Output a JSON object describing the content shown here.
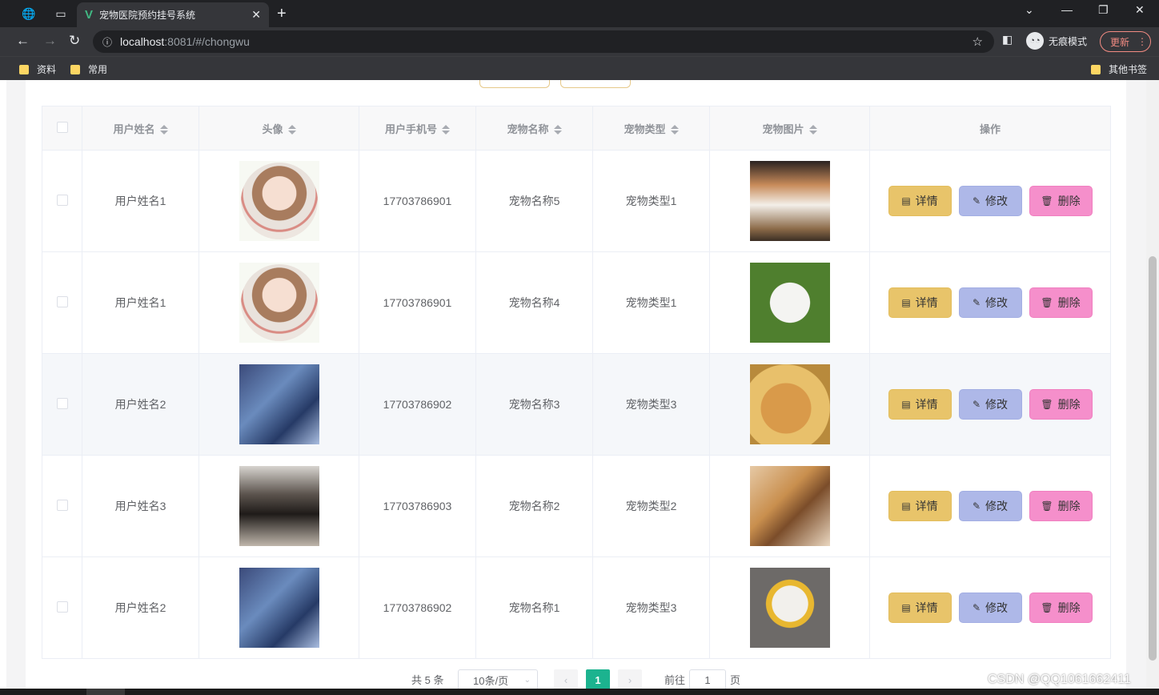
{
  "browser": {
    "tab_title": "宠物医院预约挂号系统",
    "url_host": "localhost",
    "url_path": ":8081/#/chongwu",
    "incognito_label": "无痕模式",
    "update_label": "更新",
    "bookmarks": [
      "资料",
      "常用"
    ],
    "other_bookmarks": "其他书签"
  },
  "table": {
    "headers": [
      "用户姓名",
      "头像",
      "用户手机号",
      "宠物名称",
      "宠物类型",
      "宠物图片",
      "操作"
    ],
    "rows": [
      {
        "name": "用户姓名1",
        "avatar": "avatar-girl",
        "phone": "17703786901",
        "pet_name": "宠物名称5",
        "pet_type": "宠物类型1",
        "pet_img": "corgi"
      },
      {
        "name": "用户姓名1",
        "avatar": "avatar-girl",
        "phone": "17703786901",
        "pet_name": "宠物名称4",
        "pet_type": "宠物类型1",
        "pet_img": "westie"
      },
      {
        "name": "用户姓名2",
        "avatar": "avatar-boy-blue",
        "phone": "17703786902",
        "pet_name": "宠物名称3",
        "pet_type": "宠物类型3",
        "pet_img": "golden"
      },
      {
        "name": "用户姓名3",
        "avatar": "avatar-boy-gray",
        "phone": "17703786903",
        "pet_name": "宠物名称2",
        "pet_type": "宠物类型2",
        "pet_img": "puppy"
      },
      {
        "name": "用户姓名2",
        "avatar": "avatar-boy-blue",
        "phone": "17703786902",
        "pet_name": "宠物名称1",
        "pet_type": "宠物类型3",
        "pet_img": "maltese"
      }
    ],
    "actions": {
      "detail": "详情",
      "edit": "修改",
      "delete": "删除"
    }
  },
  "pagination": {
    "total": "共 5 条",
    "page_size": "10条/页",
    "current_page": "1",
    "goto_label": "前往",
    "goto_value": "1",
    "page_suffix": "页"
  },
  "watermark": "CSDN @QQ1061662411",
  "colors": {
    "detail": "#e8c46a",
    "edit": "#aeb8e8",
    "delete": "#f58fcb",
    "current_page": "#1cb38f"
  }
}
